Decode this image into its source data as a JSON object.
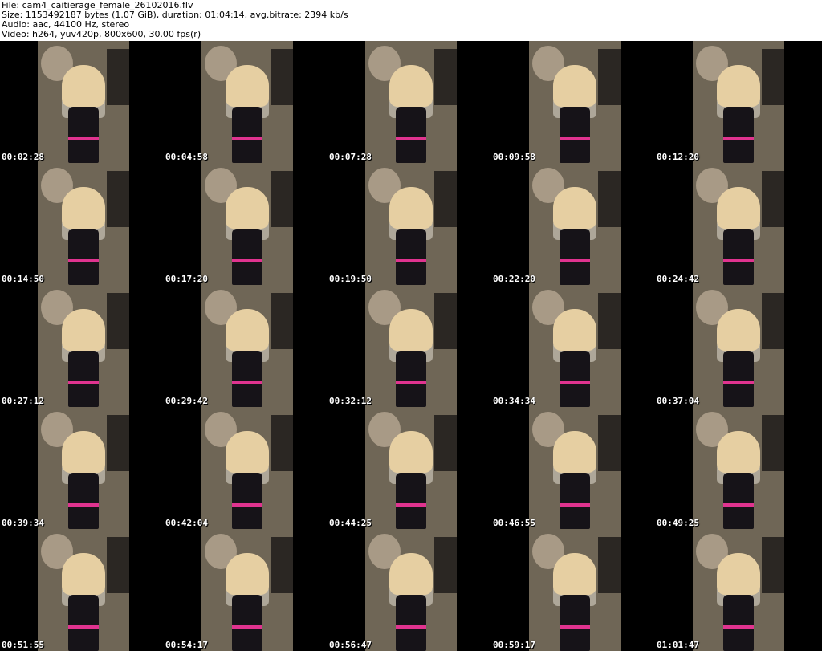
{
  "header": {
    "file_line": "File: cam4_caitierage_female_26102016.flv",
    "size_line": "Size: 1153492187 bytes (1.07 GiB), duration: 01:04:14, avg.bitrate: 2394 kb/s",
    "audio_line": "Audio: aac, 44100 Hz, stereo",
    "video_line": "Video: h264, yuv420p, 800x600, 30.00 fps(r)"
  },
  "thumbnails": [
    "00:02:28",
    "00:04:58",
    "00:07:28",
    "00:09:58",
    "00:12:20",
    "00:14:50",
    "00:17:20",
    "00:19:50",
    "00:22:20",
    "00:24:42",
    "00:27:12",
    "00:29:42",
    "00:32:12",
    "00:34:34",
    "00:37:04",
    "00:39:34",
    "00:42:04",
    "00:44:25",
    "00:46:55",
    "00:49:25",
    "00:51:55",
    "00:54:17",
    "00:56:47",
    "00:59:17",
    "01:01:47"
  ],
  "colors": {
    "header_bg": "#ffffff",
    "grid_bg": "#000000",
    "timestamp_text": "#ffffff",
    "accent_pink": "#e0338f"
  }
}
